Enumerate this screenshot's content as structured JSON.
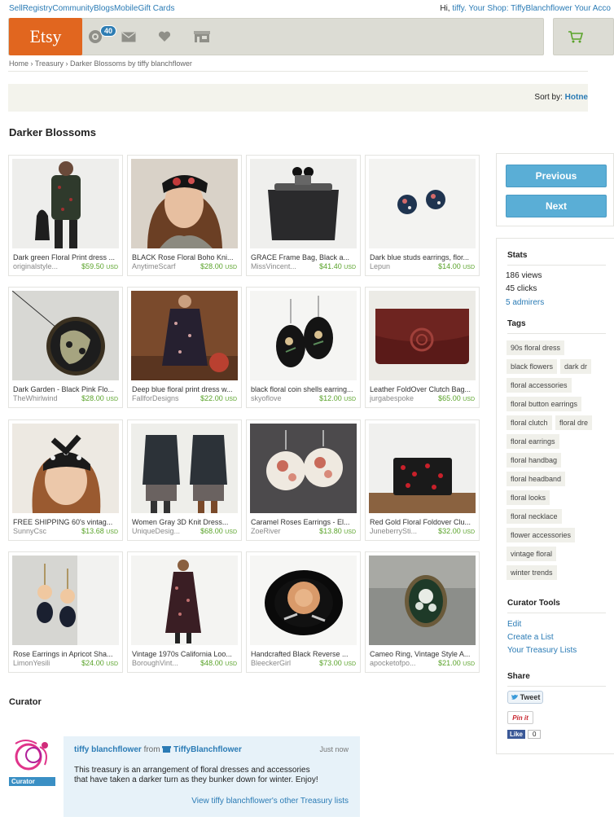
{
  "top_nav": {
    "links": [
      "Sell",
      "Registry",
      "Community",
      "Blogs",
      "Mobile",
      "Gift Cards"
    ],
    "greeting_hi": "Hi,",
    "user": "tiffy.",
    "your_shop_label": "Your Shop:",
    "shop_name": "TiffyBlanchflower",
    "account_label": "Your Acco"
  },
  "header": {
    "logo": "Etsy",
    "notification_count": "40"
  },
  "breadcrumb": "Home › Treasury › Darker Blossoms by tiffy blanchflower",
  "sort": {
    "label": "Sort by:",
    "value": "Hotne"
  },
  "page_title": "Darker Blossoms",
  "items": [
    {
      "title": "Dark green Floral Print dress ...",
      "shop": "originalstyle...",
      "price": "$59.50",
      "currency": "USD"
    },
    {
      "title": "BLACK Rose Floral Boho Kni...",
      "shop": "AnytimeScarf",
      "price": "$28.00",
      "currency": "USD"
    },
    {
      "title": "GRACE Frame Bag, Black a...",
      "shop": "MissVincent...",
      "price": "$41.40",
      "currency": "USD"
    },
    {
      "title": "Dark blue studs earrings, flor...",
      "shop": "Lepun",
      "price": "$14.00",
      "currency": "USD"
    },
    {
      "title": "Dark Garden - Black Pink Flo...",
      "shop": "TheWhirlwind",
      "price": "$28.00",
      "currency": "USD"
    },
    {
      "title": "Deep blue floral print dress w...",
      "shop": "FallforDesigns",
      "price": "$22.00",
      "currency": "USD"
    },
    {
      "title": "black floral coin shells earring...",
      "shop": "skyoflove",
      "price": "$12.00",
      "currency": "USD"
    },
    {
      "title": "Leather FoldOver Clutch Bag...",
      "shop": "jurgabespoke",
      "price": "$65.00",
      "currency": "USD"
    },
    {
      "title": "FREE SHIPPING 60's vintag...",
      "shop": "SunnyCsc",
      "price": "$13.68",
      "currency": "USD"
    },
    {
      "title": "Women Gray 3D Knit Dress...",
      "shop": "UniqueDesig...",
      "price": "$68.00",
      "currency": "USD"
    },
    {
      "title": "Caramel Roses Earrings - El...",
      "shop": "ZoeRiver",
      "price": "$13.80",
      "currency": "USD"
    },
    {
      "title": "Red Gold Floral Foldover Clu...",
      "shop": "JuneberrySti...",
      "price": "$32.00",
      "currency": "USD"
    },
    {
      "title": "Rose Earrings in Apricot Sha...",
      "shop": "LimonYesili",
      "price": "$24.00",
      "currency": "USD"
    },
    {
      "title": "Vintage 1970s California Loo...",
      "shop": "BoroughVint...",
      "price": "$48.00",
      "currency": "USD"
    },
    {
      "title": "Handcrafted Black Reverse ...",
      "shop": "BleeckerGirl",
      "price": "$73.00",
      "currency": "USD"
    },
    {
      "title": "Cameo Ring, Vintage Style A...",
      "shop": "apocketofpo...",
      "price": "$21.00",
      "currency": "USD"
    }
  ],
  "nav_buttons": {
    "previous": "Previous",
    "next": "Next"
  },
  "stats": {
    "heading": "Stats",
    "views": "186 views",
    "clicks": "45 clicks",
    "admirers": "5 admirers"
  },
  "tags": {
    "heading": "Tags",
    "list": [
      "90s floral dress",
      "black flowers",
      "dark dr",
      "floral accessories",
      "floral button earrings",
      "floral clutch",
      "floral dre",
      "floral earrings",
      "floral handbag",
      "floral headband",
      "floral looks",
      "floral necklace",
      "flower accessories",
      "vintage floral",
      "winter trends"
    ]
  },
  "curator_tools": {
    "heading": "Curator Tools",
    "links": [
      "Edit",
      "Create a List",
      "Your Treasury Lists"
    ]
  },
  "share": {
    "heading": "Share",
    "tweet": "Tweet",
    "pin": "Pin it",
    "like": "Like",
    "like_count": "0"
  },
  "curator": {
    "heading": "Curator",
    "avatar_label": "Curator",
    "name": "tiffy blanchflower",
    "from": "from",
    "shop": "TiffyBlanchflower",
    "time": "Just now",
    "description": "This treasury is an arrangement of floral dresses and accessories that have taken a darker turn as they bunker down for winter. Enjoy!",
    "other_lists": "View tiffy blanchflower's other Treasury lists"
  },
  "colors": {
    "etsy_orange": "#e1661f",
    "link_blue": "#2a7bb5",
    "price_green": "#5aa32a",
    "button_blue": "#5aaed6"
  }
}
